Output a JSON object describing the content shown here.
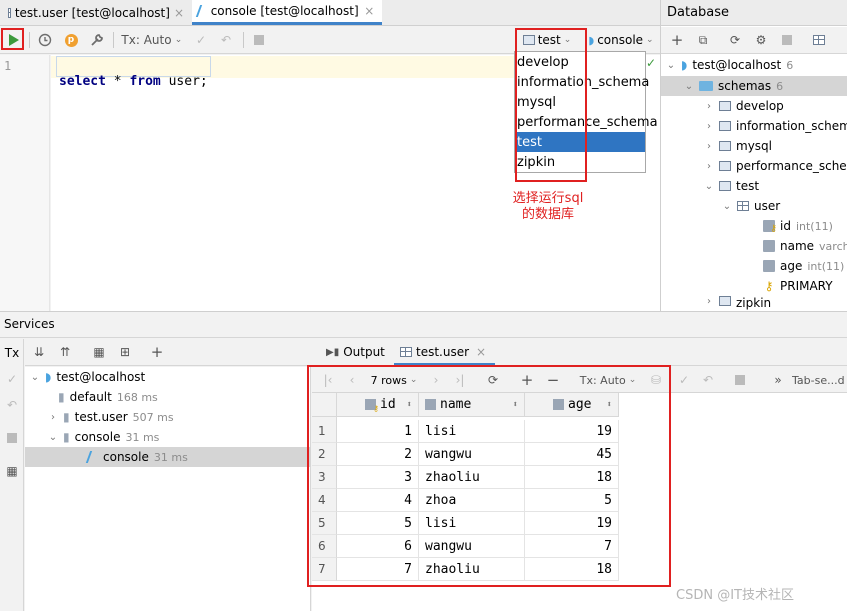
{
  "editor_tabs": [
    {
      "label": "test.user [test@localhost]",
      "active": false
    },
    {
      "label": "console [test@localhost]",
      "active": true
    }
  ],
  "editor_toolbar": {
    "tx_label": "Tx: Auto",
    "schema_label": "test",
    "session_label": "console"
  },
  "editor": {
    "line_number": "1",
    "code": {
      "kw1": "select",
      "star": " * ",
      "kw2": "from",
      "rest": " user;"
    }
  },
  "schema_dropdown": {
    "items": [
      "develop",
      "information_schema",
      "mysql",
      "performance_schema",
      "test",
      "zipkin"
    ],
    "selected": "test"
  },
  "annotation": {
    "line1": "选择运行sql",
    "line2": "的数据库"
  },
  "database_panel": {
    "title": "Database",
    "tree": {
      "connection": {
        "label": "test@localhost",
        "badge": "6"
      },
      "schemas": {
        "label": "schemas",
        "badge": "6"
      },
      "items": [
        "develop",
        "information_schema",
        "mysql",
        "performance_schema"
      ],
      "test": "test",
      "user_table": "user",
      "columns": [
        {
          "name": "id",
          "type": "int(11)"
        },
        {
          "name": "name",
          "type": "varchar"
        },
        {
          "name": "age",
          "type": "int(11)"
        }
      ],
      "primary": "PRIMARY",
      "zipkin": "zipkin"
    }
  },
  "services": {
    "title": "Services",
    "tx_label": "Tx",
    "tree": {
      "root": "test@localhost",
      "children": [
        {
          "label": "default",
          "time": "168 ms"
        },
        {
          "label": "test.user",
          "time": "507 ms"
        },
        {
          "label": "console",
          "time": "31 ms"
        },
        {
          "label": "console",
          "time": "31 ms"
        }
      ]
    },
    "result_tabs": [
      "Output",
      "test.user"
    ],
    "result_toolbar": {
      "rows_label": "7 rows",
      "tx_label": "Tx: Auto",
      "tab_label": "Tab-se...d"
    },
    "grid": {
      "columns": [
        "id",
        "name",
        "age"
      ],
      "rows": [
        {
          "n": "1",
          "id": "1",
          "name": "lisi",
          "age": "19"
        },
        {
          "n": "2",
          "id": "2",
          "name": "wangwu",
          "age": "45"
        },
        {
          "n": "3",
          "id": "3",
          "name": "zhaoliu",
          "age": "18"
        },
        {
          "n": "4",
          "id": "4",
          "name": "zhoa",
          "age": "5"
        },
        {
          "n": "5",
          "id": "5",
          "name": "lisi",
          "age": "19"
        },
        {
          "n": "6",
          "id": "6",
          "name": "wangwu",
          "age": "7"
        },
        {
          "n": "7",
          "id": "7",
          "name": "zhaoliu",
          "age": "18"
        }
      ]
    }
  },
  "watermark": "CSDN @IT技术社区",
  "colors": {
    "keyword": "#000080",
    "highlight_line": "#fffae3",
    "selection": "#2f75c2",
    "annotation": "#e02020"
  }
}
